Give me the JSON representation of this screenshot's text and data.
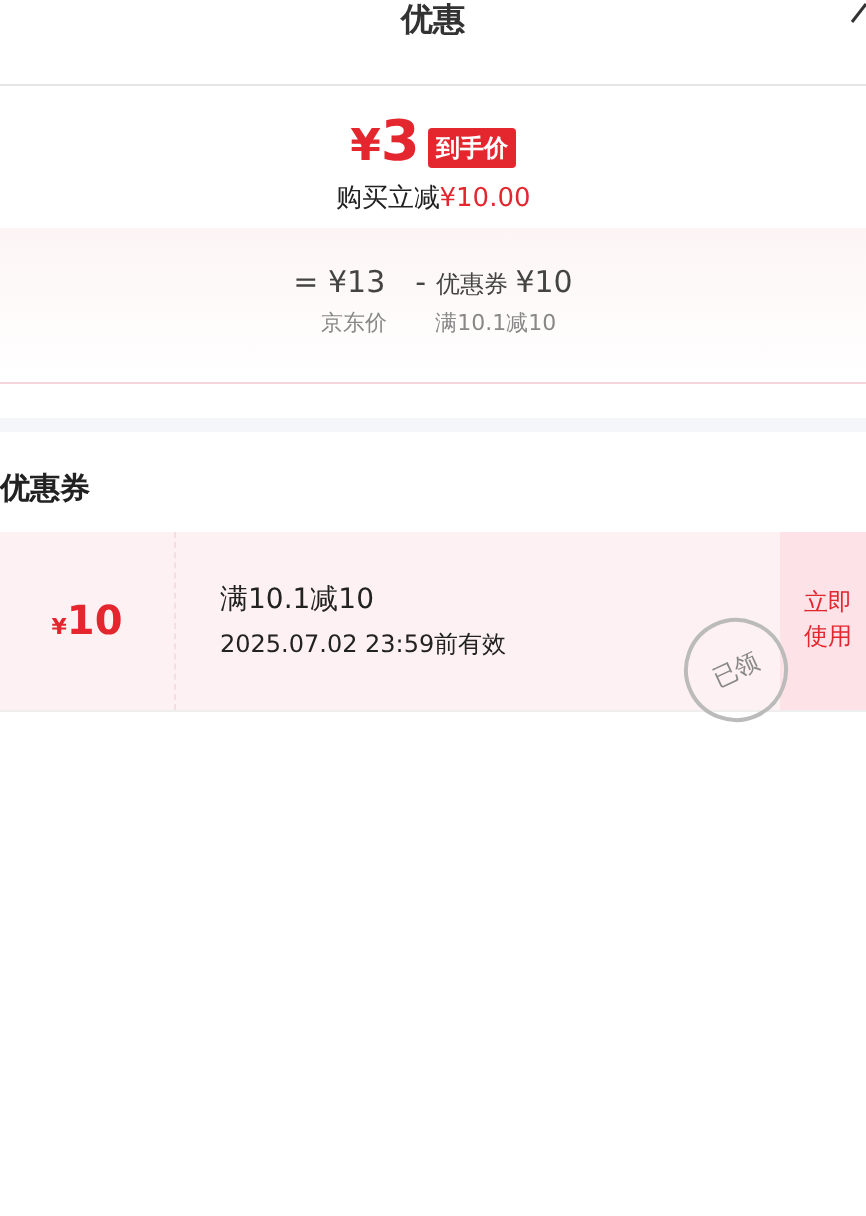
{
  "header": {
    "title": "优惠"
  },
  "price": {
    "currency": "¥",
    "amount": "3",
    "badge": "到手价",
    "saving_label": "购买立减",
    "saving_amount": "¥10.00"
  },
  "breakdown": [
    {
      "op": "=",
      "value": "¥13",
      "label": "京东价"
    },
    {
      "op": "-",
      "prefix": "优惠券",
      "value": "¥10",
      "label": "满10.1减10"
    }
  ],
  "section_title": "优惠券",
  "coupons": [
    {
      "currency": "¥",
      "amount": "10",
      "condition": "满10.1减10",
      "validity": "2025.07.02 23:59前有效",
      "claimed": true,
      "stamp": "已领",
      "action": "立即使用"
    }
  ]
}
